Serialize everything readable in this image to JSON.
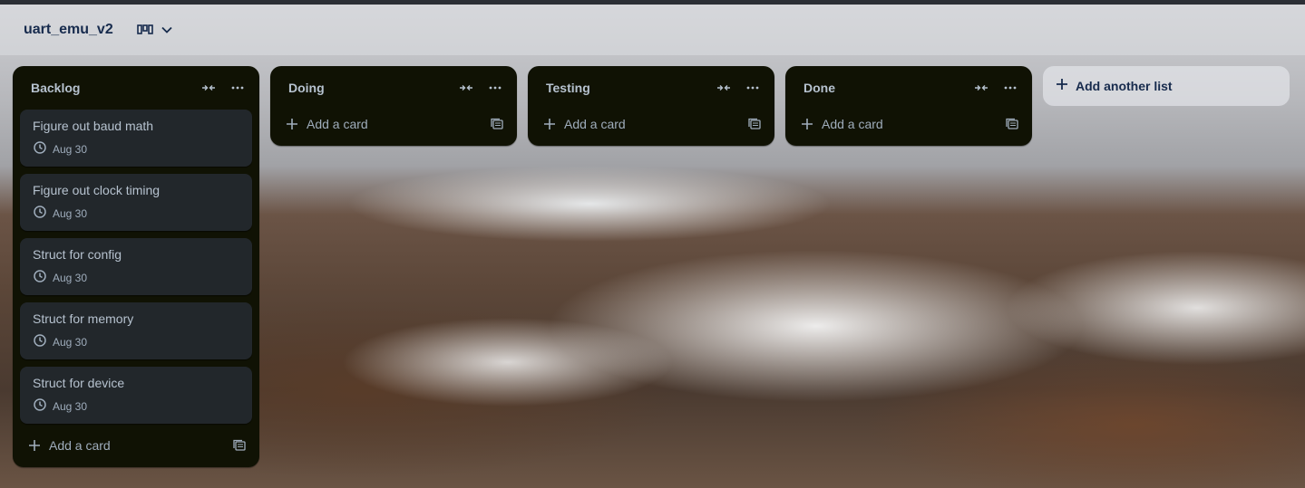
{
  "board": {
    "title": "uart_emu_v2",
    "view_icon": "board-view-icon"
  },
  "colors": {
    "list_bg": "#101204",
    "card_bg": "#22272b",
    "text": "#b6c2cf",
    "header_text": "#172b4d"
  },
  "lists": [
    {
      "title": "Backlog",
      "cards": [
        {
          "title": "Figure out baud math",
          "due": "Aug 30"
        },
        {
          "title": "Figure out clock timing",
          "due": "Aug 30"
        },
        {
          "title": "Struct for config",
          "due": "Aug 30"
        },
        {
          "title": "Struct for memory",
          "due": "Aug 30"
        },
        {
          "title": "Struct for device",
          "due": "Aug 30"
        }
      ],
      "add_card_label": "Add a card"
    },
    {
      "title": "Doing",
      "cards": [],
      "add_card_label": "Add a card"
    },
    {
      "title": "Testing",
      "cards": [],
      "add_card_label": "Add a card"
    },
    {
      "title": "Done",
      "cards": [],
      "add_card_label": "Add a card"
    }
  ],
  "add_list_label": "Add another list"
}
